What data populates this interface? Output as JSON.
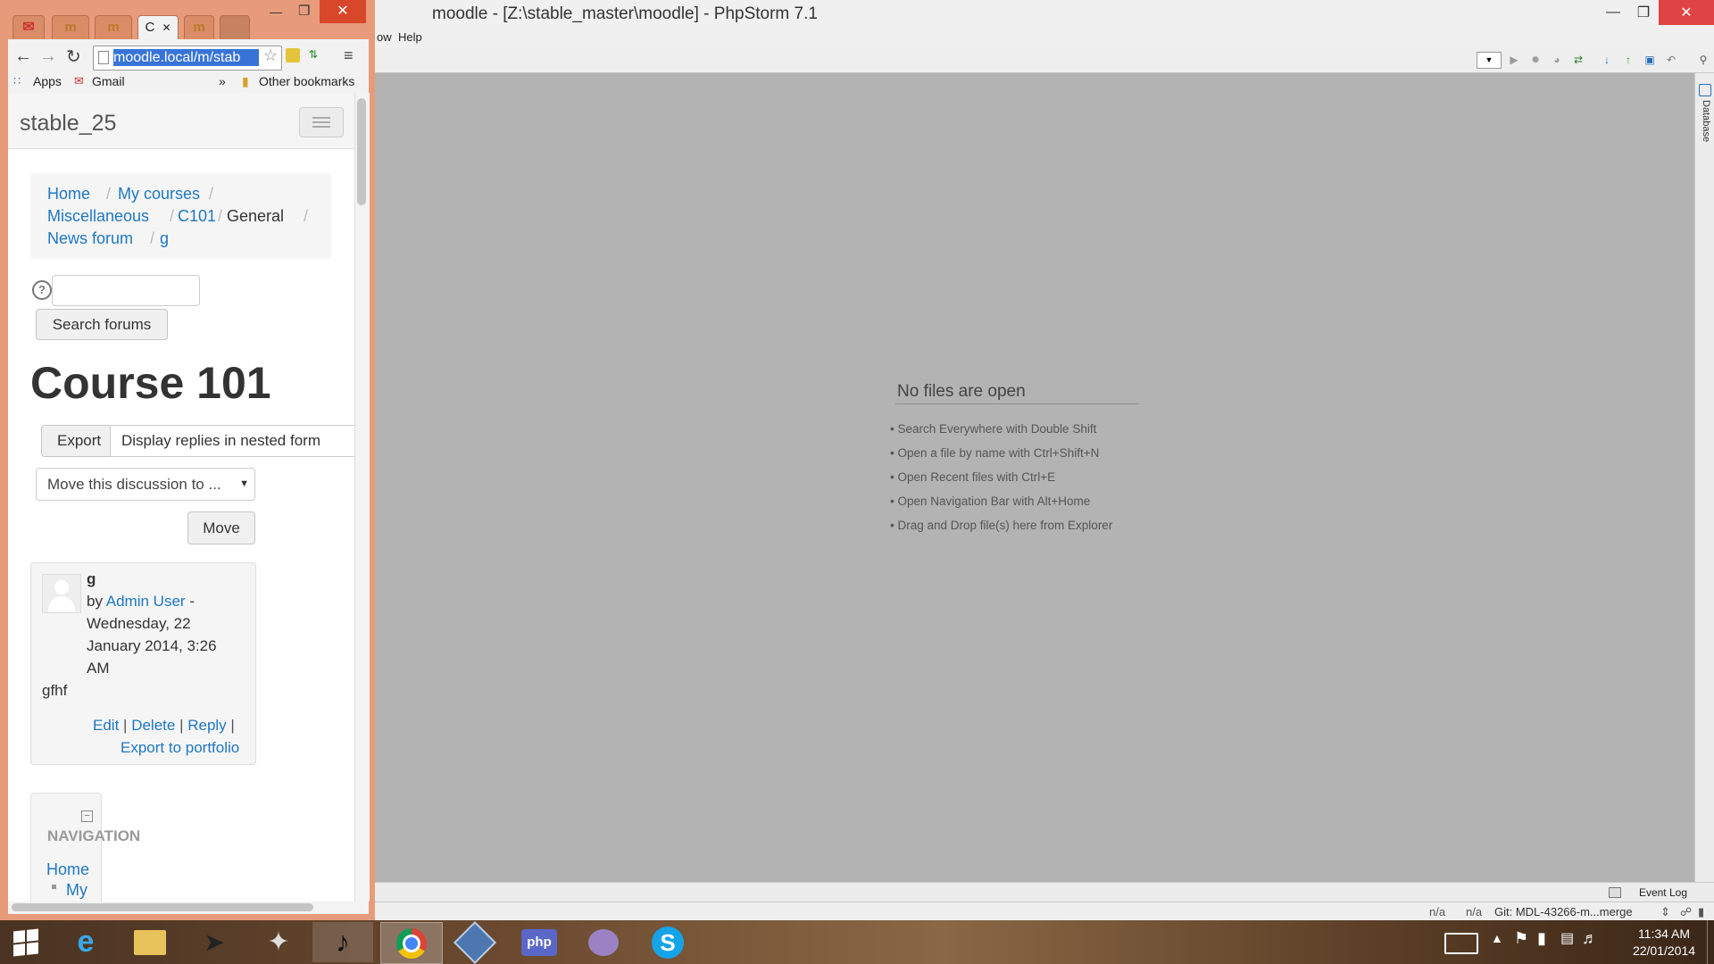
{
  "phpstorm": {
    "title": "moodle - [Z:\\stable_master\\moodle] - PhpStorm 7.1",
    "menu": [
      "ow",
      "Help"
    ],
    "tool_window_database": "Database",
    "empty_editor": {
      "title": "No files are open",
      "hints": [
        "• Search Everywhere with Double Shift",
        "• Open a file by name with Ctrl+Shift+N",
        "• Open Recent files with Ctrl+E",
        "• Open Navigation Bar with Alt+Home",
        "• Drag and Drop file(s) here from Explorer"
      ]
    },
    "event_log": "Event Log",
    "status": {
      "pos1": "n/a",
      "pos2": "n/a",
      "git": "Git: MDL-43266-m...merge"
    }
  },
  "chrome": {
    "tabs": [
      "",
      "m",
      "m",
      "C",
      "m"
    ],
    "url": "moodle.local/m/stab",
    "bookmarks": {
      "apps": "Apps",
      "gmail": "Gmail",
      "more": "»",
      "other": "Other bookmarks"
    }
  },
  "moodle": {
    "site_name": "stable_25",
    "breadcrumb": {
      "home": "Home",
      "my_courses": "My courses",
      "misc": "Miscellaneous",
      "c101": "C101",
      "general": "General",
      "news_forum": "News forum",
      "g": "g"
    },
    "search_button": "Search forums",
    "course_title": "Course 101",
    "export_button": "Export",
    "display_mode": "Display replies in nested form",
    "move_select": "Move this discussion to ...",
    "move_button": "Move",
    "post": {
      "subject": "g",
      "by": "by",
      "author": "Admin User",
      "date_lines": [
        "Wednesday, 22",
        "January 2014, 3:26",
        "AM"
      ],
      "dash": "-",
      "message": "gfhf",
      "actions": {
        "edit": "Edit",
        "delete": "Delete",
        "reply": "Reply",
        "export": "Export to portfolio"
      }
    },
    "navigation": {
      "title": "NAVIGATION",
      "home": "Home",
      "my": "My"
    }
  },
  "taskbar": {
    "time": "11:34 AM",
    "date": "22/01/2014"
  }
}
